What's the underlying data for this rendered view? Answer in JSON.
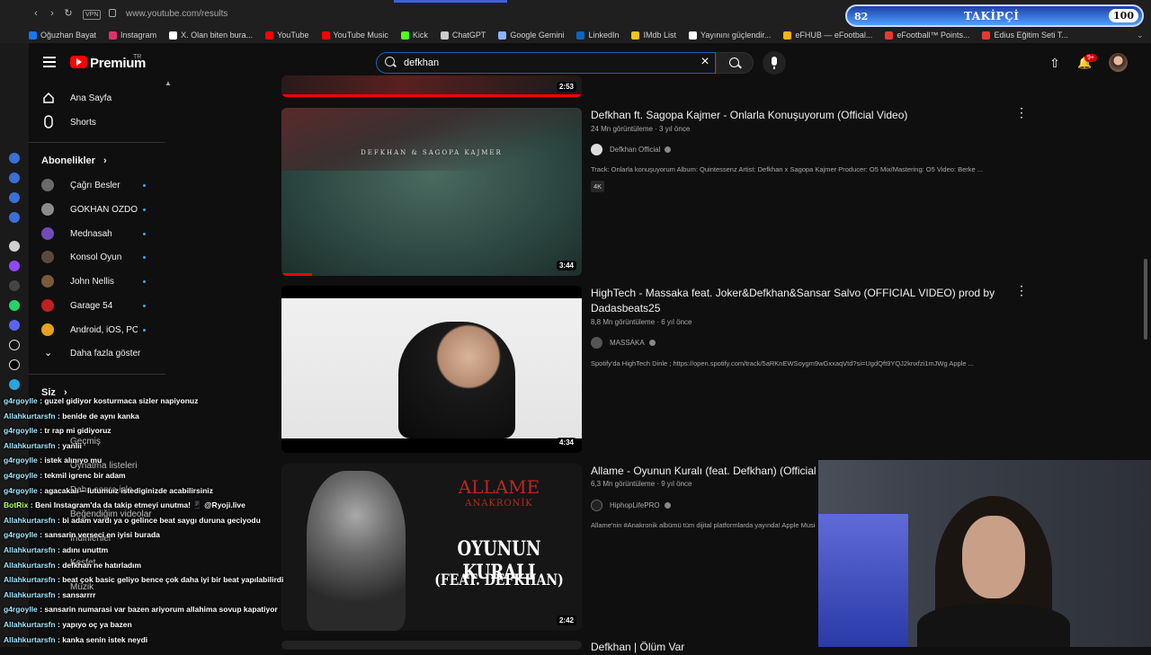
{
  "browser": {
    "url": "www.youtube.com/results",
    "vpn_label": "VPN",
    "bookmarks": [
      {
        "label": "Oğuzhan Bayat",
        "color": "#1877f2"
      },
      {
        "label": "Instagram",
        "color": "#e1306c"
      },
      {
        "label": "X. Olan biten bura...",
        "color": "#ffffff"
      },
      {
        "label": "YouTube",
        "color": "#ff0000"
      },
      {
        "label": "YouTube Music",
        "color": "#ff0000"
      },
      {
        "label": "Kick",
        "color": "#53fc18"
      },
      {
        "label": "ChatGPT",
        "color": "#cccccc"
      },
      {
        "label": "Google Gemini",
        "color": "#8ab4f8"
      },
      {
        "label": "LinkedIn",
        "color": "#0a66c2"
      },
      {
        "label": "IMdb List",
        "color": "#f5c518"
      },
      {
        "label": "Yayınını güçlendir...",
        "color": "#ffffff"
      },
      {
        "label": "eFHUB — eFootbal...",
        "color": "#ffb300"
      },
      {
        "label": "eFootball™ Points...",
        "color": "#e53935"
      },
      {
        "label": "Edius Eğitim Seti T...",
        "color": "#e53935"
      }
    ]
  },
  "header": {
    "logo_text": "Premium",
    "logo_region": "TR",
    "search_value": "defkhan",
    "notifications_badge": "9+"
  },
  "nav": {
    "home": "Ana Sayfa",
    "shorts": "Shorts",
    "subscriptions_title": "Abonelikler",
    "subscriptions": [
      {
        "name": "Çağrı Besler",
        "color": "#6a6a6a"
      },
      {
        "name": "GÖKHAN ÖZDO...",
        "color": "#8c8c8c"
      },
      {
        "name": "Mednasah",
        "color": "#6f4bb8"
      },
      {
        "name": "Konsol Oyun",
        "color": "#5a4a3a"
      },
      {
        "name": "John Nellis",
        "color": "#7a5a3a"
      },
      {
        "name": "Garage 54",
        "color": "#c02020"
      },
      {
        "name": "Android, iOS, PC ...",
        "color": "#e8a020"
      }
    ],
    "show_more": "Daha fazla göster",
    "you_title": "Siz",
    "you_items": [
      "Geçmiş",
      "Oynatma listeleri",
      "Daha sonra izle",
      "Beğendiğim videolar",
      "İndirilenler",
      "Keşfet",
      "Müzik"
    ]
  },
  "results": [
    {
      "title": "Defkhan ft. Sagopa Kajmer - Onlarla Konuşuyorum (Official Video)",
      "views": "24 Mn görüntüleme · 3 yıl önce",
      "channel": "Defkhan Official",
      "description": "Track: Onlarla konuşuyorum Album: Quintessenz Artist: Defkhan x Sagopa Kajmer Producer: O5 Mix/Mastering: O5 Video: Berke ...",
      "badge": "4K",
      "duration": "3:44",
      "thumb_text": "DEFKHAN & SAGOPA KAJMER"
    },
    {
      "title": "HighTech - Massaka feat. Joker&Defkhan&Sansar Salvo (OFFICIAL VIDEO) prod by",
      "title2": "Dadasbeats25",
      "views": "8,8 Mn görüntüleme · 6 yıl önce",
      "channel": "MASSAKA",
      "description": "Spotify'da HighTech Dinle ; https://open.spotify.com/track/5aRKnEWSoygm9wGxxaqVtd?si=UgdQft9YQJ2knxfzi1mJWg Apple ...",
      "duration": "4:34"
    },
    {
      "title": "Allame - Oyunun Kuralı (feat. Defkhan) (Official Video)",
      "views": "6,3 Mn görüntüleme · 9 yıl önce",
      "channel": "HiphopLifePRO",
      "description": "Allame'nin #Anakronik albümü tüm dijital platformlarda yayında! Apple Music ...",
      "duration": "2:42",
      "thumb_line1": "ALLAME",
      "thumb_line2": "ANAKRONİK",
      "thumb_line3": "OYUNUN KURALI",
      "thumb_line4": "(FEAT. DEFKHAN)"
    }
  ],
  "partial_top": {
    "duration": "2:53"
  },
  "partial_bottom": {
    "title": "Defkhan | Ölüm Var"
  },
  "overlay": {
    "follower_count": "82",
    "follower_label": "TAKİPÇİ",
    "follower_goal": "100"
  },
  "chat": [
    {
      "user": "g4rgoylle",
      "msg": "guzel gidiyor kosturmaca sizler napiyonuz",
      "color": "#9ee6ff"
    },
    {
      "user": "Allahkurtarsfn",
      "msg": "benide de aynı kanka",
      "color": "#9ee6ff"
    },
    {
      "user": "g4rgoylle",
      "msg": "tr rap mi gidiyoruz",
      "color": "#9ee6ff"
    },
    {
      "user": "Allahkurtarsfn",
      "msg": "yanlii",
      "color": "#9ee6ff"
    },
    {
      "user": "g4rgoylle",
      "msg": "istek alınıyo mu",
      "color": "#9ee6ff"
    },
    {
      "user": "g4rgoylle",
      "msg": "tekmil igrenc bir adam",
      "color": "#9ee6ff"
    },
    {
      "user": "g4rgoylle",
      "msg": "agacakalı – lutumuız istediginizde acabilirsiniz",
      "color": "#9ee6ff"
    },
    {
      "user": "BotRix",
      "msg": "Beni Instagram'da da takip etmeyi unutma! 📱 @Ryoji.live",
      "color": "#b4ff6a"
    },
    {
      "user": "Allahkurtarsfn",
      "msg": "bi adam vardı ya o gelince beat saygı duruna geciyodu",
      "color": "#9ee6ff"
    },
    {
      "user": "g4rgoylle",
      "msg": "sansarin verseci en iyisi burada",
      "color": "#9ee6ff"
    },
    {
      "user": "Allahkurtarsfn",
      "msg": "adını unuttm",
      "color": "#9ee6ff"
    },
    {
      "user": "Allahkurtarsfn",
      "msg": "defkhan ne hatırladım",
      "color": "#9ee6ff"
    },
    {
      "user": "Allahkurtarsfn",
      "msg": "beat çok basic geliyo bence çok daha iyi bir beat yapılabilirdi",
      "color": "#9ee6ff"
    },
    {
      "user": "Allahkurtarsfn",
      "msg": "sansarrrr",
      "color": "#9ee6ff"
    },
    {
      "user": "g4rgoylle",
      "msg": "sansarin numarasi var bazen ariyorum allahima sovup kapatiyor",
      "color": "#9ee6ff"
    },
    {
      "user": "Allahkurtarsfn",
      "msg": "yapıyo oç ya bazen",
      "color": "#9ee6ff"
    },
    {
      "user": "Allahkurtarsfn",
      "msg": "kanka senin istek neydi",
      "color": "#9ee6ff"
    }
  ]
}
